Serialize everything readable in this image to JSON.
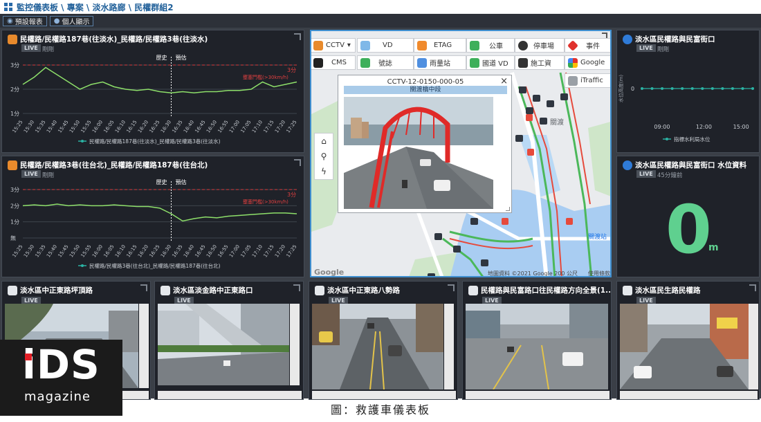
{
  "breadcrumb": {
    "path": "監控儀表板 \\ 專案 \\ 淡水路廊 \\ 民權群組2"
  },
  "toolbar": {
    "preset_report": "預設報表",
    "personal_display": "個人顯示"
  },
  "travel_panels": [
    {
      "title": "民權路/民權路187巷(往淡水)_民權路/民權路3巷(往淡水)",
      "live": "LIVE",
      "updated": "剛剛",
      "legend": "民權路/民權路187巷(往淡水)_民權路/民權路3巷(往淡水)",
      "history_label": "歷史",
      "forecast_label": "預估",
      "threshold_label": "3分",
      "warning_label": "壅塞門檻(>30km/h)"
    },
    {
      "title": "民權路/民權路3巷(往台北)_民權路/民權路187巷(往台北)",
      "live": "LIVE",
      "updated": "剛剛",
      "legend": "民權路/民權路3巷(往台北)_民權路/民權路187巷(往台北)",
      "history_label": "歷史",
      "forecast_label": "預估",
      "threshold_label": "3分",
      "warning_label": "壅塞門檻(>30km/h)"
    }
  ],
  "chart_data": [
    {
      "type": "line",
      "x": [
        "15:25",
        "15:30",
        "15:35",
        "15:40",
        "15:45",
        "15:50",
        "15:55",
        "16:00",
        "16:05",
        "16:10",
        "16:15",
        "16:20",
        "16:25",
        "16:30",
        "16:35",
        "16:40",
        "16:45",
        "16:50",
        "16:55",
        "17:00",
        "17:05",
        "17:10",
        "17:15",
        "17:20",
        "17:25"
      ],
      "y_ticks": [
        "3分",
        "2分",
        "1分"
      ],
      "ylim": [
        1,
        3
      ],
      "threshold": 3,
      "series": [
        {
          "name": "民權路/民權路187巷(往淡水)_民權路/民權路3巷(往淡水)",
          "color": "#8ee06a",
          "values": [
            2.2,
            2.5,
            2.9,
            2.6,
            2.3,
            2.0,
            2.2,
            2.3,
            2.1,
            2.0,
            1.95,
            2.0,
            1.9,
            1.85,
            1.9,
            1.85,
            1.9,
            1.9,
            1.95,
            1.95,
            2.0,
            2.3,
            2.1,
            2.2,
            2.3
          ]
        }
      ]
    },
    {
      "type": "line",
      "x": [
        "15:25",
        "15:30",
        "15:35",
        "15:40",
        "15:45",
        "15:50",
        "15:55",
        "16:00",
        "16:05",
        "16:10",
        "16:15",
        "16:20",
        "16:25",
        "16:30",
        "16:35",
        "16:40",
        "16:45",
        "16:50",
        "16:55",
        "17:00",
        "17:05",
        "17:10",
        "17:15",
        "17:20",
        "17:25"
      ],
      "y_ticks": [
        "3分",
        "2分",
        "1分",
        "無"
      ],
      "ylim": [
        0,
        3
      ],
      "threshold": 3,
      "series": [
        {
          "name": "民權路/民權路3巷(往台北)_民權路/民權路187巷(往台北)",
          "color": "#8ee06a",
          "values": [
            2.0,
            2.05,
            2.0,
            2.1,
            2.0,
            2.05,
            2.0,
            2.0,
            2.05,
            2.0,
            1.95,
            1.95,
            1.85,
            1.5,
            1.05,
            1.2,
            1.3,
            1.25,
            1.35,
            1.4,
            1.45,
            1.5,
            1.55,
            1.55,
            1.5
          ]
        }
      ]
    },
    {
      "type": "line",
      "x": [
        "09:00",
        "12:00",
        "15:00"
      ],
      "ylabel": "水位高度(m)",
      "y_ticks": [
        "0"
      ],
      "ylim": [
        -1,
        1
      ],
      "series": [
        {
          "name": "指標水利局水位",
          "color": "#2bb3a4",
          "values": [
            0,
            0,
            0,
            0,
            0,
            0,
            0,
            0,
            0,
            0,
            0,
            0
          ]
        }
      ]
    }
  ],
  "map": {
    "layers": [
      {
        "label": "CCTV",
        "color": "#333333"
      },
      {
        "label": "VD",
        "color": "#7fb8e8"
      },
      {
        "label": "ETAG",
        "color": "#f08a2c"
      },
      {
        "label": "公車",
        "color": "#3daf5a"
      },
      {
        "label": "停車場",
        "color": "#333333"
      },
      {
        "label": "事件",
        "color": "#e0312d"
      },
      {
        "label": "CMS",
        "color": "#222222"
      },
      {
        "label": "號誌",
        "color": "#3daf5a"
      },
      {
        "label": "雨量站",
        "color": "#4f8fe0"
      },
      {
        "label": "國道 VD",
        "color": "#3daf5a"
      },
      {
        "label": "施工資",
        "color": "#333333"
      },
      {
        "label": "Google",
        "color": "#e0312d"
      },
      {
        "label": "iTraffic",
        "color": "#9aa0a6"
      }
    ],
    "popup_title": "CCTV-12-0150-000-05",
    "popup_subtitle": "關渡橋中段",
    "map_label_guandu": "關渡",
    "map_label_station": "關渡站",
    "attribution": "地圖資料 ©2021 Google  200 公尺",
    "terms": "使用條款",
    "google": "Google"
  },
  "water_panels": [
    {
      "title": "淡水區民權路與民富街口",
      "live": "LIVE",
      "updated": "剛剛",
      "legend": "指標水利局水位"
    },
    {
      "title": "淡水區民權路與民富街口 水位資料",
      "live": "LIVE",
      "updated": "45分鐘前",
      "value": "0",
      "unit": "m"
    }
  ],
  "cameras": [
    {
      "title": "淡水區中正東路坪頂路",
      "live": "LIVE"
    },
    {
      "title": "淡水區淡金路中正東路口",
      "live": "LIVE"
    },
    {
      "title": "淡水區中正東路八勢路",
      "live": "LIVE"
    },
    {
      "title": "民權路與民富路口往民權路方向全景(1...",
      "live": "LIVE"
    },
    {
      "title": "淡水區民生路民權路",
      "live": "LIVE"
    }
  ],
  "logo": {
    "ids": "iDS",
    "magazine": "magazine"
  },
  "caption": "圖：救護車儀表板"
}
